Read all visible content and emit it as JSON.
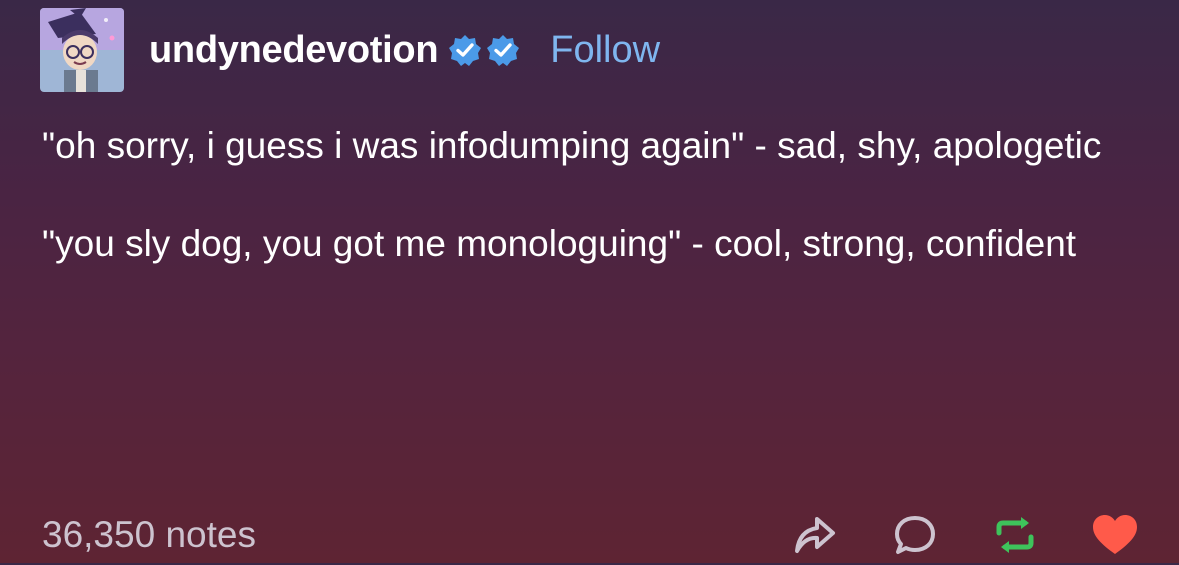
{
  "post": {
    "author": "undynedevotion",
    "follow_label": "Follow",
    "paragraphs": [
      "\"oh sorry, i guess i was infodumping again\" - sad, shy, apologetic",
      "\"you sly dog, you got me monologuing\" - cool, strong, confident"
    ],
    "notes": "36,350 notes"
  },
  "icons": {
    "badge_1": "verified-badge-icon",
    "badge_2": "verified-badge-icon",
    "share": "share-icon",
    "reply": "reply-icon",
    "reblog": "reblog-icon",
    "like": "heart-icon"
  },
  "colors": {
    "follow": "#7fb6ef",
    "badge": "#4b9ae8",
    "reblog": "#3ec35b",
    "like": "#ff5a4a",
    "muted_text": "#cdc3cf"
  }
}
